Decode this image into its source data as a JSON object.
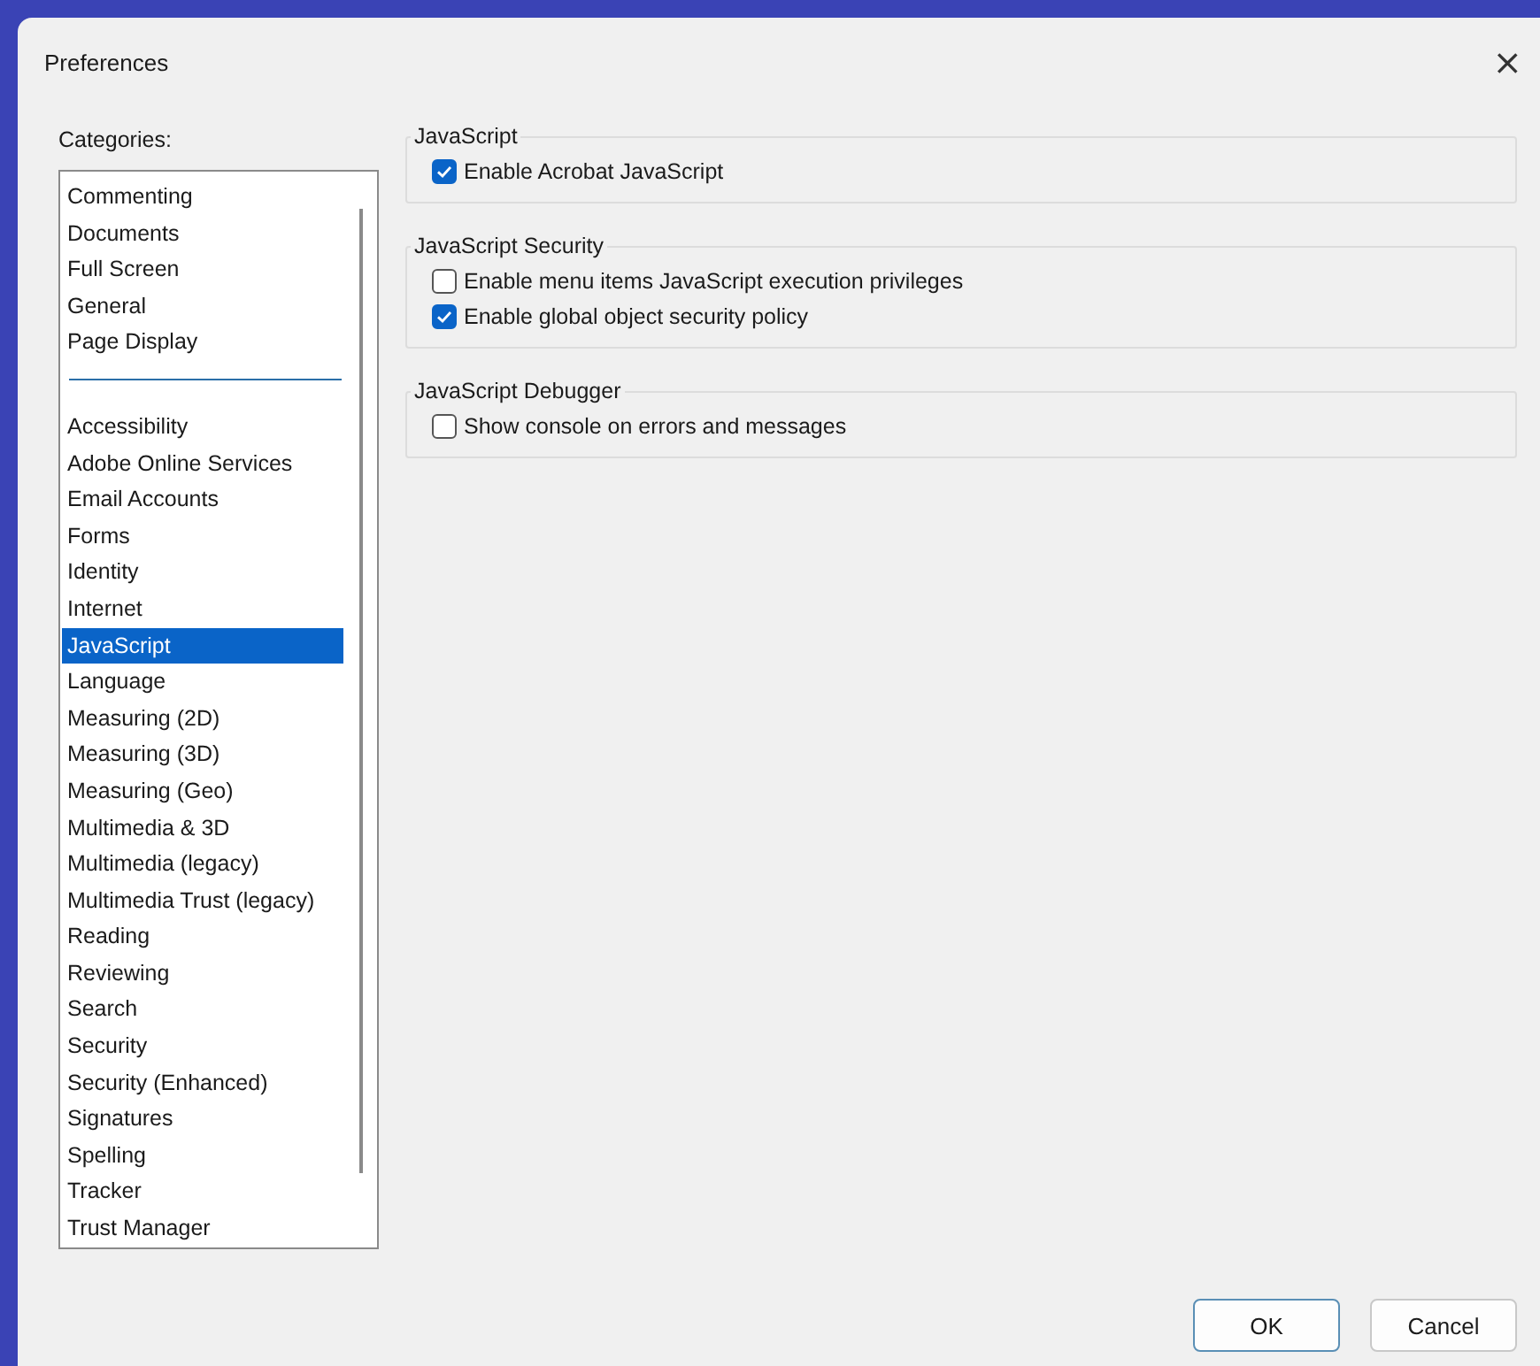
{
  "window": {
    "title": "Preferences",
    "close": "×"
  },
  "categories": {
    "label": "Categories:",
    "groups": [
      [
        {
          "label": "Commenting",
          "selected": false
        },
        {
          "label": "Documents",
          "selected": false
        },
        {
          "label": "Full Screen",
          "selected": false
        },
        {
          "label": "General",
          "selected": false
        },
        {
          "label": "Page Display",
          "selected": false
        }
      ],
      [
        {
          "label": "Accessibility",
          "selected": false
        },
        {
          "label": "Adobe Online Services",
          "selected": false
        },
        {
          "label": "Email Accounts",
          "selected": false
        },
        {
          "label": "Forms",
          "selected": false
        },
        {
          "label": "Identity",
          "selected": false
        },
        {
          "label": "Internet",
          "selected": false
        },
        {
          "label": "JavaScript",
          "selected": true
        },
        {
          "label": "Language",
          "selected": false
        },
        {
          "label": "Measuring (2D)",
          "selected": false
        },
        {
          "label": "Measuring (3D)",
          "selected": false
        },
        {
          "label": "Measuring (Geo)",
          "selected": false
        },
        {
          "label": "Multimedia & 3D",
          "selected": false
        },
        {
          "label": "Multimedia (legacy)",
          "selected": false
        },
        {
          "label": "Multimedia Trust (legacy)",
          "selected": false
        },
        {
          "label": "Reading",
          "selected": false
        },
        {
          "label": "Reviewing",
          "selected": false
        },
        {
          "label": "Search",
          "selected": false
        },
        {
          "label": "Security",
          "selected": false
        },
        {
          "label": "Security (Enhanced)",
          "selected": false
        },
        {
          "label": "Signatures",
          "selected": false
        },
        {
          "label": "Spelling",
          "selected": false
        },
        {
          "label": "Tracker",
          "selected": false
        },
        {
          "label": "Trust Manager",
          "selected": false
        }
      ]
    ]
  },
  "sections": [
    {
      "title": "JavaScript",
      "options": [
        {
          "label": "Enable Acrobat JavaScript",
          "checked": true
        }
      ]
    },
    {
      "title": "JavaScript Security",
      "options": [
        {
          "label": "Enable menu items JavaScript execution privileges",
          "checked": false
        },
        {
          "label": "Enable global object security policy",
          "checked": true
        }
      ]
    },
    {
      "title": "JavaScript Debugger",
      "options": [
        {
          "label": "Show console on errors and messages",
          "checked": false
        }
      ]
    }
  ],
  "buttons": [
    {
      "label": "OK",
      "default": true
    },
    {
      "label": "Cancel",
      "default": false
    }
  ]
}
